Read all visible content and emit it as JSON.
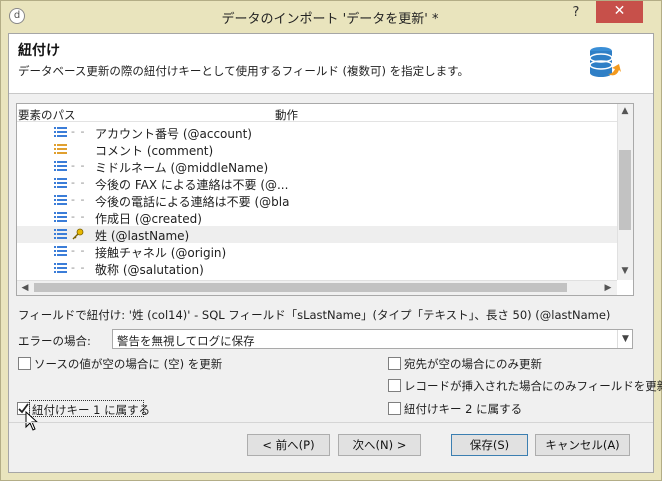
{
  "window": {
    "title": "データのインポート 'データを更新' *",
    "app_icon": "app-icon",
    "help_label": "?",
    "close_label": "✕"
  },
  "header": {
    "title": "紐付け",
    "description": "データベース更新の際の紐付けキーとして使用するフィールド (複数可) を指定します。",
    "icon": "database-refresh-icon"
  },
  "tree": {
    "columns": [
      "要素のパス",
      "動作"
    ],
    "rows": [
      {
        "label": "アカウント番号 (@account)",
        "icon": "field-icon",
        "selected": false,
        "key": false
      },
      {
        "label": "コメント (comment)",
        "icon": "memo-field-icon",
        "selected": false,
        "key": false
      },
      {
        "label": "ミドルネーム (@middleName)",
        "icon": "field-icon",
        "selected": false,
        "key": false
      },
      {
        "label": "今後の FAX による連絡は不要 (@...",
        "icon": "field-icon",
        "selected": false,
        "key": false
      },
      {
        "label": "今後の電話による連絡は不要 (@bla",
        "icon": "field-icon",
        "selected": false,
        "key": false
      },
      {
        "label": "作成日 (@created)",
        "icon": "field-icon",
        "selected": false,
        "key": false
      },
      {
        "label": "姓 (@lastName)",
        "icon": "field-icon",
        "selected": true,
        "key": true
      },
      {
        "label": "接触チャネル (@origin)",
        "icon": "field-icon",
        "selected": false,
        "key": false
      },
      {
        "label": "敬称 (@salutation)",
        "icon": "field-icon",
        "selected": false,
        "key": false
      }
    ]
  },
  "info_line": "フィールドで紐付け: '姓 (col14)' - SQL フィールド「sLastName」(タイプ「テキスト」、長さ 50) (@lastName)",
  "error": {
    "label": "エラーの場合:",
    "value": "警告を無視してログに保存"
  },
  "options": {
    "update_if_source_empty": {
      "label": "ソースの値が空の場合に (空) を更新",
      "checked": false
    },
    "update_if_dest_empty": {
      "label": "宛先が空の場合にのみ更新",
      "checked": false
    },
    "update_only_on_insert": {
      "label": "レコードが挿入された場合にのみフィールドを更新",
      "checked": false
    },
    "key1": {
      "label": "紐付けキー 1 に属する",
      "checked": true
    },
    "key2": {
      "label": "紐付けキー 2 に属する",
      "checked": false
    }
  },
  "buttons": {
    "back": "< 前へ(P)",
    "next": "次へ(N) >",
    "save": "保存(S)",
    "cancel": "キャンセル(A)"
  }
}
